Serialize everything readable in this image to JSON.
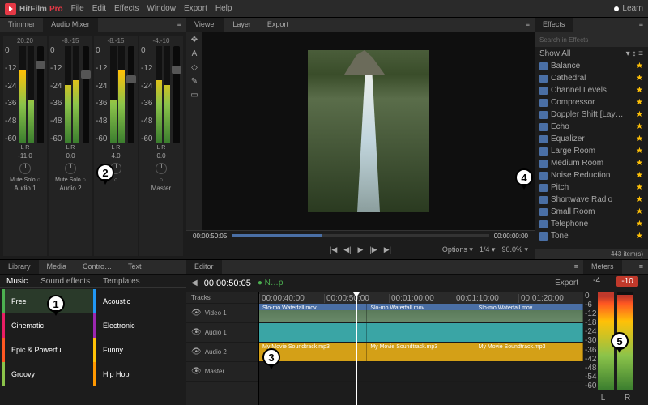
{
  "app": {
    "name": "HitFilm",
    "suffix": "Pro"
  },
  "menu": [
    "File",
    "Edit",
    "Effects",
    "Window",
    "Export",
    "Help"
  ],
  "learn": "Learn",
  "mixer": {
    "tabs": [
      "Trimmer",
      "Audio Mixer"
    ],
    "channels": [
      {
        "top": "20.20",
        "db": "-11.0",
        "name": "Audio 1",
        "btns": "Mute Solo"
      },
      {
        "top": "-8.-15",
        "db": "0.0",
        "name": "Audio 2",
        "btns": "Mute Solo"
      },
      {
        "top": "-8.-15",
        "db": "4.0",
        "name": "",
        "btns": ""
      },
      {
        "top": "-4.-10",
        "db": "0.0",
        "name": "Master",
        "btns": ""
      }
    ],
    "lr": "L  R"
  },
  "viewer": {
    "tabs": [
      "Viewer",
      "Layer",
      "Export"
    ],
    "tools": [
      "✥",
      "A",
      "◇",
      "✎",
      "▭"
    ],
    "time_cur": "00:00:50:05",
    "time_end": "00:00:00:00",
    "controls": [
      "|◀",
      "◀|",
      "▶",
      "|▶",
      "▶|"
    ],
    "options": "Options ▾",
    "scale": "1/4 ▾",
    "zoom": "90.0% ▾"
  },
  "effects": {
    "tab": "Effects",
    "search": "Search in Effects",
    "filter": "Show All",
    "items": [
      "Balance",
      "Cathedral",
      "Channel Levels",
      "Compressor",
      "Doppler Shift [Lay…",
      "Echo",
      "Equalizer",
      "Large Room",
      "Medium Room",
      "Noise Reduction",
      "Pitch",
      "Shortwave Radio",
      "Small Room",
      "Telephone",
      "Tone"
    ],
    "count": "443 item(s)"
  },
  "library": {
    "tabs": [
      "Library",
      "Media",
      "Contro…",
      "Text"
    ],
    "subtabs": [
      "Music",
      "Sound effects",
      "Templates"
    ],
    "cats": [
      "Free",
      "Acoustic",
      "Cinematic",
      "Electronic",
      "Epic & Powerful",
      "Funny",
      "Groovy",
      "Hip Hop"
    ]
  },
  "editor": {
    "tab": "Editor",
    "time": "00:00:50:05",
    "comp": "● N…p",
    "export": "Export",
    "tracks_header": "Tracks",
    "ruler": [
      "00:00:40:00",
      "00:00:50:00",
      "00:01:00:00",
      "00:01:10:00",
      "00:01:20:00"
    ],
    "tracks": [
      {
        "label": "Video 1",
        "clip": "Slo-mo Waterfall.mov",
        "type": "v"
      },
      {
        "label": "Audio 1",
        "clip": "",
        "type": "a1"
      },
      {
        "label": "Audio 2",
        "clip": "My Movie Soundtrack.mp3",
        "type": "a2"
      },
      {
        "label": "Master",
        "clip": "",
        "type": "m"
      }
    ]
  },
  "meters": {
    "tab": "Meters",
    "vals": [
      "-4",
      "-10"
    ],
    "scale": [
      "0",
      "-6",
      "-12",
      "-18",
      "-24",
      "-30",
      "-36",
      "-42",
      "-48",
      "-54",
      "-60"
    ],
    "lr": [
      "L",
      "R"
    ]
  },
  "callouts": [
    "1",
    "2",
    "3",
    "4",
    "5"
  ]
}
